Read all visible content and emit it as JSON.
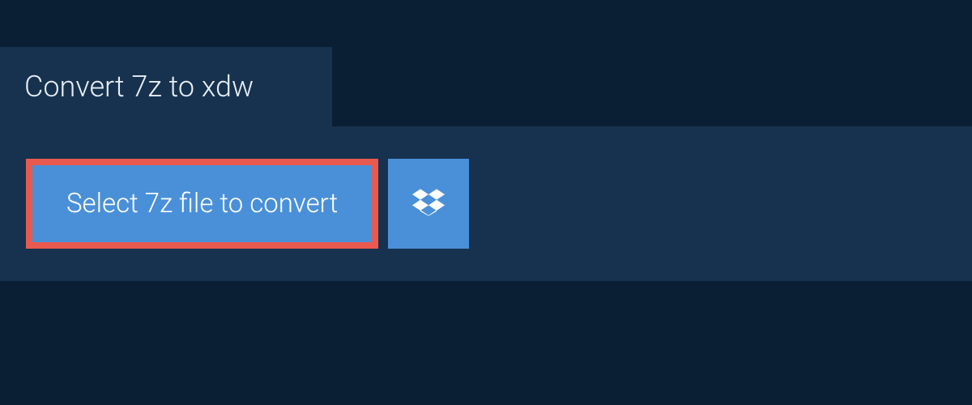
{
  "tab": {
    "title": "Convert 7z to xdw"
  },
  "actions": {
    "select_label": "Select 7z file to convert",
    "dropbox_icon": "dropbox"
  }
}
